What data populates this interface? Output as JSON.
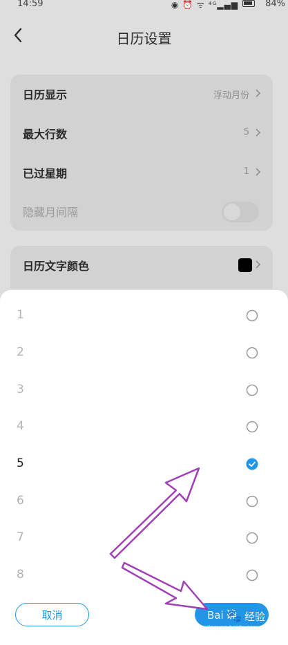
{
  "status_bar": {
    "time": "14:59",
    "icons_text": "◉ ⏰ ᯤ ⁴ᴳ▂▄▆",
    "battery": "84%"
  },
  "header": {
    "title": "日历设置"
  },
  "settings_group_1": {
    "items": [
      {
        "label": "日历显示",
        "value": "浮动月份"
      },
      {
        "label": "最大行数",
        "value": "5"
      },
      {
        "label": "已过星期",
        "value": "1"
      },
      {
        "label": "隐藏月间隔",
        "toggle_on": false
      }
    ]
  },
  "settings_group_2": {
    "items": [
      {
        "label": "日历文字颜色",
        "swatch_color": "#000000"
      }
    ]
  },
  "picker": {
    "options": [
      "1",
      "2",
      "3",
      "4",
      "5",
      "6",
      "7",
      "8"
    ],
    "selected": "5",
    "cancel_label": "取消",
    "confirm_label": "确"
  },
  "watermark": {
    "text": "Bai",
    "text2": "经验",
    "sub": "jingyan.baidu.com"
  },
  "colors": {
    "accent": "#2196e6",
    "arrow": "#a040b8"
  }
}
